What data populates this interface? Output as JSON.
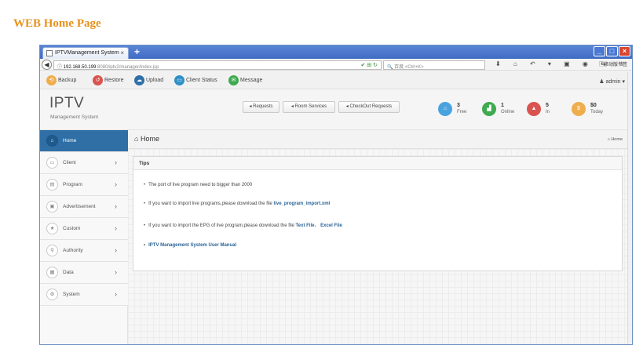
{
  "page_heading": "WEB Home Page",
  "browser": {
    "tab_title": "IPTVManagement System",
    "tab_close": "×",
    "new_tab": "+",
    "url_host": "192.168.50.199",
    "url_path": ":8080/iptv2/manager/index.jsp",
    "search_placeholder": "百度 <Ctrl+K>",
    "toolbar_icons": "⬇ ⌂ ↶ ▾ ▣ ◉ ⇆ ☆ ◫ ▼ ☰",
    "bookmarks_label": "移动版书签",
    "window_min": "_",
    "window_max": "□",
    "window_close": "×"
  },
  "topbar": {
    "items": [
      {
        "label": "Backup",
        "icon": "backup-icon",
        "color": "#f0ad4e",
        "glyph": "⟲"
      },
      {
        "label": "Restore",
        "icon": "restore-icon",
        "color": "#d9534f",
        "glyph": "↺"
      },
      {
        "label": "Upload",
        "icon": "upload-icon",
        "color": "#2f6fa6",
        "glyph": "☁"
      },
      {
        "label": "Client Status",
        "icon": "monitor-icon",
        "color": "#2f8fc7",
        "glyph": "▭"
      },
      {
        "label": "Message",
        "icon": "message-icon",
        "color": "#3faa4f",
        "glyph": "✉"
      }
    ],
    "admin_label": "admin"
  },
  "header": {
    "logo": "IPTV",
    "logo_sub": "Management System",
    "buttons": [
      {
        "label": "Requests"
      },
      {
        "label": "Room Services"
      },
      {
        "label": "CheckOut Requests"
      }
    ],
    "stats": [
      {
        "value": "3",
        "label": "Free",
        "color": "#4aa3df",
        "glyph": "⌂",
        "icon": "home-icon"
      },
      {
        "value": "1",
        "label": "Online",
        "color": "#3faa4f",
        "glyph": "▟",
        "icon": "signal-icon"
      },
      {
        "value": "5",
        "label": "In",
        "color": "#d9534f",
        "glyph": "▲",
        "icon": "lock-icon"
      },
      {
        "value": "$0",
        "label": "Today",
        "color": "#f0ad4e",
        "glyph": "$",
        "icon": "money-icon"
      }
    ]
  },
  "sidebar": {
    "items": [
      {
        "label": "Home",
        "glyph": "⌂",
        "active": true
      },
      {
        "label": "Client",
        "glyph": "▭",
        "active": false
      },
      {
        "label": "Program",
        "glyph": "▤",
        "active": false
      },
      {
        "label": "Advertisement",
        "glyph": "▣",
        "active": false
      },
      {
        "label": "Custom",
        "glyph": "★",
        "active": false
      },
      {
        "label": "Authority",
        "glyph": "⚲",
        "active": false
      },
      {
        "label": "Data",
        "glyph": "▦",
        "active": false
      },
      {
        "label": "System",
        "glyph": "⚙",
        "active": false
      }
    ],
    "arrow": "›"
  },
  "main": {
    "title": "Home",
    "crumb": "Home",
    "panel_title": "Tips",
    "tip1": "The port of live program need to bigger than 2000",
    "tip2_text": "If you want to import live programs,please download the file",
    "tip2_link": "live_program_import.xml",
    "tip3_text": "If you want to import the EPG of live program,please download the file",
    "tip3_link1": "Text File",
    "tip3_sep": "、",
    "tip3_link2": "Excel File",
    "tip4_link": "IPTV Management System User Manual"
  }
}
